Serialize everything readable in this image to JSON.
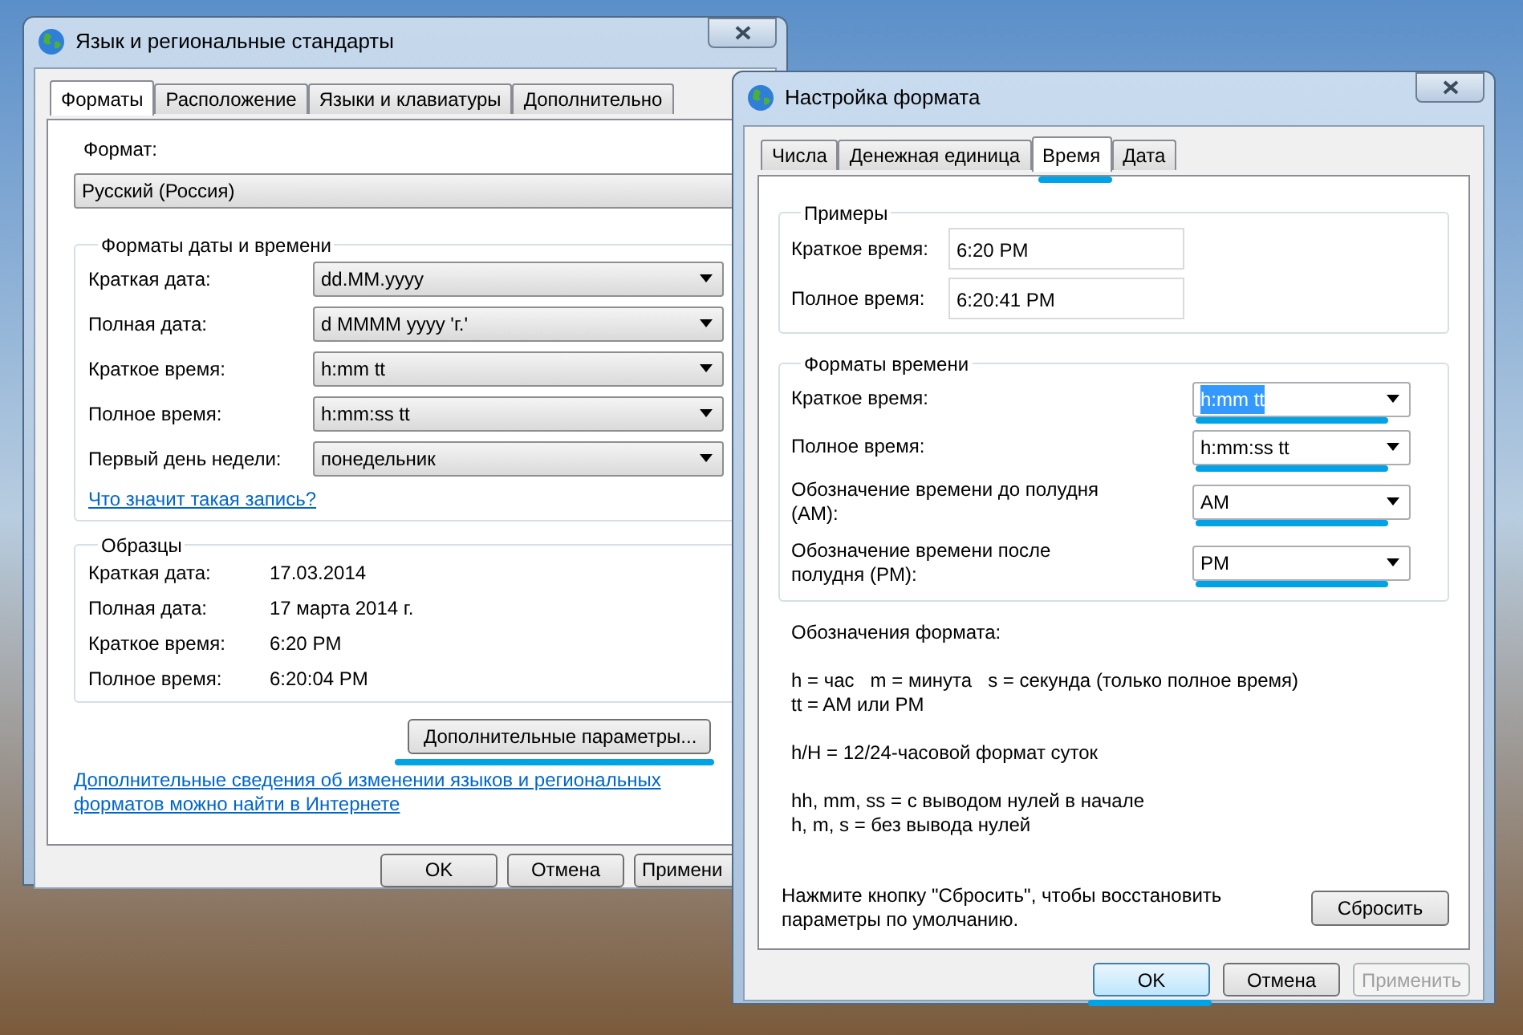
{
  "regional_window": {
    "title": "Язык и региональные стандарты",
    "tabs": [
      {
        "label": "Форматы",
        "selected": true
      },
      {
        "label": "Расположение",
        "selected": false
      },
      {
        "label": "Языки и клавиатуры",
        "selected": false
      },
      {
        "label": "Дополнительно",
        "selected": false
      }
    ],
    "format": {
      "label": "Формат:",
      "value": "Русский (Россия)"
    },
    "datetime_group": {
      "title": "Форматы даты и времени",
      "rows": [
        {
          "label": "Краткая дата:",
          "value": "dd.MM.yyyy"
        },
        {
          "label": "Полная дата:",
          "value": "d MMMM yyyy 'г.'"
        },
        {
          "label": "Краткое время:",
          "value": "h:mm tt"
        },
        {
          "label": "Полное время:",
          "value": "h:mm:ss tt"
        },
        {
          "label": "Первый день недели:",
          "value": "понедельник"
        }
      ],
      "help_link": "Что значит такая запись?"
    },
    "samples_group": {
      "title": "Образцы",
      "rows": [
        {
          "label": "Краткая дата:",
          "value": "17.03.2014"
        },
        {
          "label": "Полная дата:",
          "value": "17 марта 2014 г."
        },
        {
          "label": "Краткое время:",
          "value": "6:20 PM"
        },
        {
          "label": "Полное время:",
          "value": "6:20:04 PM"
        }
      ]
    },
    "advanced_button": {
      "label": "Дополнительные параметры...",
      "underlined": true
    },
    "info_link": "Дополнительные сведения об изменении языков и региональных форматов можно найти в Интернете",
    "buttons": [
      {
        "label": "OK"
      },
      {
        "label": "Отмена"
      },
      {
        "label": "Примени"
      }
    ]
  },
  "format_window": {
    "title": "Настройка формата",
    "tabs": [
      {
        "label": "Числа",
        "selected": false,
        "underlined": false
      },
      {
        "label": "Денежная единица",
        "selected": false,
        "underlined": false
      },
      {
        "label": "Время",
        "selected": true,
        "underlined": true
      },
      {
        "label": "Дата",
        "selected": false,
        "underlined": false
      }
    ],
    "examples_group": {
      "title": "Примеры",
      "rows": [
        {
          "label": "Краткое время:",
          "value": "6:20 PM"
        },
        {
          "label": "Полное время:",
          "value": "6:20:41 PM"
        }
      ]
    },
    "formats_group": {
      "title": "Форматы времени",
      "rows": [
        {
          "label": "Краткое время:",
          "value": "h:mm tt",
          "focused": true,
          "underlined": true
        },
        {
          "label": "Полное время:",
          "value": "h:mm:ss tt",
          "focused": false,
          "underlined": true
        },
        {
          "label": "Обозначение времени до полудня (AM):",
          "value": "AM",
          "focused": false,
          "underlined": true
        },
        {
          "label": "Обозначение времени после полудня (PM):",
          "value": "PM",
          "focused": false,
          "underlined": true
        }
      ]
    },
    "legend": [
      {
        "lines": [
          "Обозначения формата:"
        ]
      },
      {
        "lines": [
          "h = час   m = минута   s = секунда (только полное время)",
          "tt = AM или PM"
        ]
      },
      {
        "lines": [
          "h/H = 12/24-часовой формат суток"
        ]
      },
      {
        "lines": [
          "hh, mm, ss = с выводом нулей в начале",
          "h, m, s = без вывода нулей"
        ]
      }
    ],
    "reset_note": "Нажмите кнопку \"Сбросить\", чтобы восстановить параметры по умолчанию.",
    "reset_button": "Сбросить",
    "buttons": [
      {
        "label": "OK",
        "default": true,
        "disabled": false,
        "underlined": true
      },
      {
        "label": "Отмена",
        "default": false,
        "disabled": false,
        "underlined": false
      },
      {
        "label": "Применить",
        "default": false,
        "disabled": true,
        "underlined": false
      }
    ]
  }
}
